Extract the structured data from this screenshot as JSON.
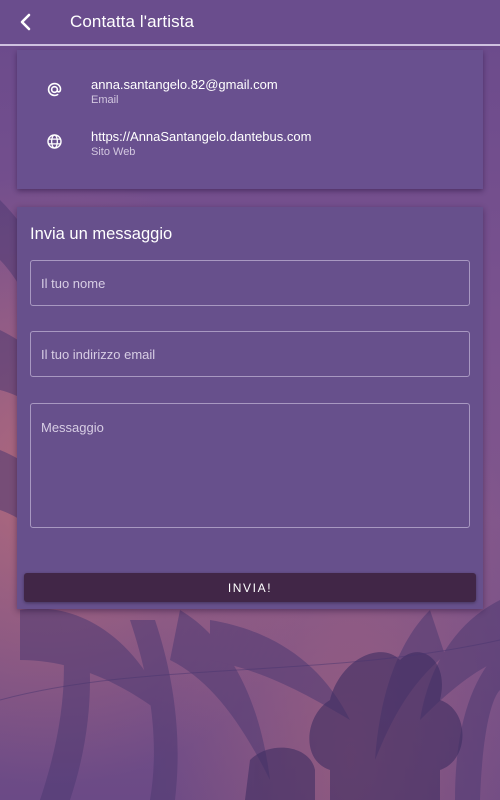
{
  "appbar": {
    "title": "Contatta l'artista",
    "back_icon": "chevron-left-icon"
  },
  "contact": {
    "email": {
      "icon": "at-sign-icon",
      "value": "anna.santangelo.82@gmail.com",
      "caption": "Email"
    },
    "website": {
      "icon": "globe-icon",
      "value": "https://AnnaSantangelo.dantebus.com",
      "caption": "Sito Web"
    }
  },
  "form": {
    "title": "Invia un messaggio",
    "name_placeholder": "Il tuo nome",
    "name_value": "",
    "email_placeholder": "Il tuo indirizzo email",
    "email_value": "",
    "message_placeholder": "Messaggio",
    "message_value": "",
    "submit_label": "INVIA!"
  },
  "colors": {
    "appbar": "#6a4d8d",
    "card": "#69508f",
    "button": "#412647",
    "text": "#ffffff"
  }
}
